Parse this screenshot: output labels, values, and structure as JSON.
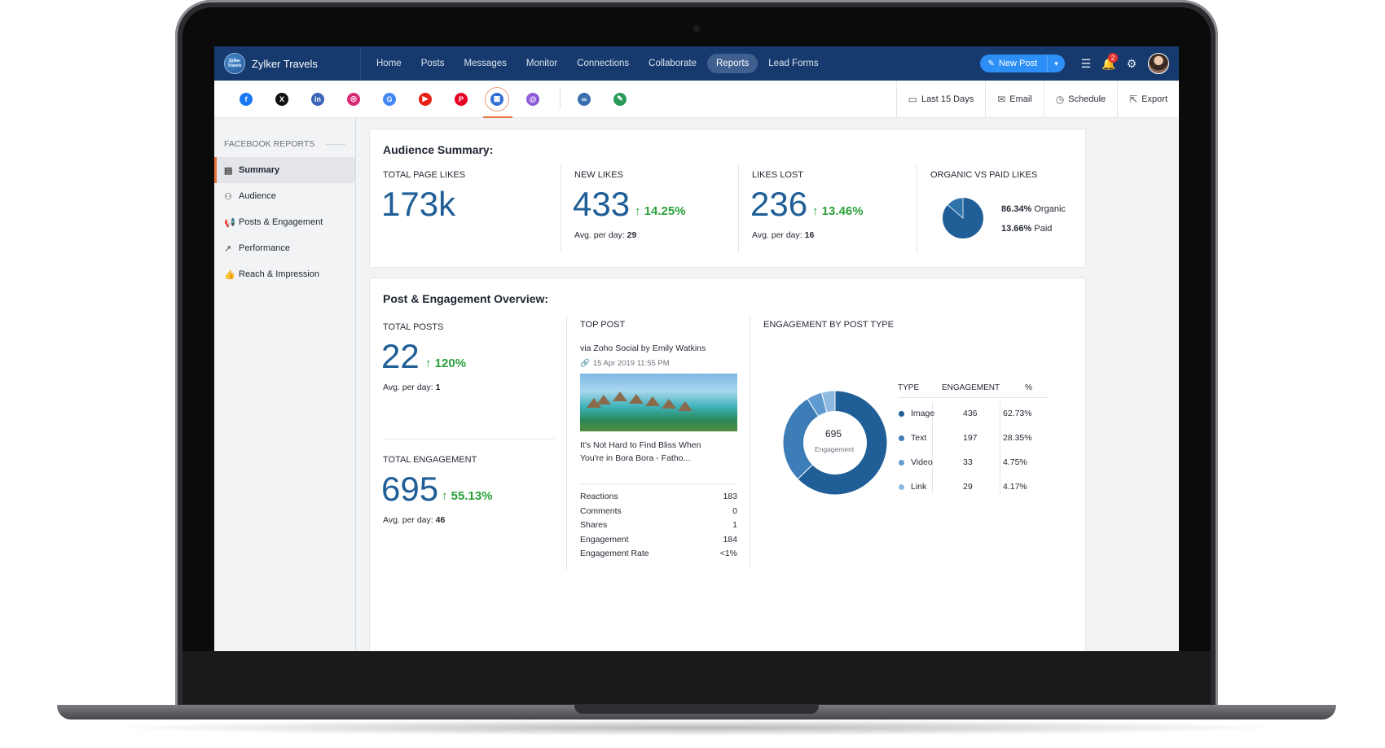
{
  "app": {
    "brand": "Zylker Travels",
    "brand_logo_text": "Zylker Travels",
    "nav": [
      "Home",
      "Posts",
      "Messages",
      "Monitor",
      "Connections",
      "Collaborate",
      "Reports",
      "Lead Forms"
    ],
    "active_nav": "Reports",
    "new_post_label": "New Post",
    "notification_count": "2"
  },
  "channels": [
    {
      "name": "facebook-channel",
      "glyph": "f",
      "color": "#1877f2"
    },
    {
      "name": "x-channel",
      "glyph": "X",
      "color": "#111111"
    },
    {
      "name": "linkedin-channel",
      "glyph": "in",
      "color": "#3a64b8"
    },
    {
      "name": "instagram-channel",
      "glyph": "◎",
      "color": "#d62976"
    },
    {
      "name": "google-channel",
      "glyph": "G",
      "color": "#4285f4"
    },
    {
      "name": "youtube-channel",
      "glyph": "▶",
      "color": "#e62117"
    },
    {
      "name": "pinterest-channel",
      "glyph": "P",
      "color": "#e60023"
    },
    {
      "name": "microsoft-channel",
      "glyph": "▦",
      "color": "#2f6fd1"
    },
    {
      "name": "threads-channel",
      "glyph": "@",
      "color": "#8e5ad6"
    }
  ],
  "extra_channels": [
    {
      "name": "link-channel",
      "glyph": "∞",
      "color": "#3a6fb0"
    },
    {
      "name": "leaf-channel",
      "glyph": "✎",
      "color": "#2a9a5a"
    }
  ],
  "actions": {
    "date_range": "Last 15 Days",
    "email": "Email",
    "schedule": "Schedule",
    "export": "Export"
  },
  "sidebar": {
    "title": "FACEBOOK REPORTS",
    "items": [
      "Summary",
      "Audience",
      "Posts & Engagement",
      "Performance",
      "Reach & Impression"
    ],
    "active": "Summary"
  },
  "audience_summary": {
    "title": "Audience Summary:",
    "total_page_likes": {
      "label": "TOTAL PAGE LIKES",
      "value": "173k"
    },
    "new_likes": {
      "label": "NEW LIKES",
      "value": "433",
      "delta": "14.25%",
      "avg_label": "Avg. per day:",
      "avg": "29"
    },
    "likes_lost": {
      "label": "LIKES LOST",
      "value": "236",
      "delta": "13.46%",
      "avg_label": "Avg. per day:",
      "avg": "16"
    },
    "organic_vs_paid": {
      "label": "ORGANIC VS PAID LIKES",
      "organic_pct": "86.34%",
      "organic_label": "Organic",
      "paid_pct": "13.66%",
      "paid_label": "Paid",
      "organic_fraction": 0.8634
    }
  },
  "post_engagement": {
    "title": "Post & Engagement Overview:",
    "total_posts": {
      "label": "TOTAL POSTS",
      "value": "22",
      "delta": "120%",
      "avg_label": "Avg. per day:",
      "avg": "1"
    },
    "total_engagement": {
      "label": "TOTAL ENGAGEMENT",
      "value": "695",
      "delta": "55.13%",
      "avg_label": "Avg. per day:",
      "avg": "46"
    },
    "top_post": {
      "label": "TOP POST",
      "via": "via Zoho Social by Emily Watkins",
      "date": "15 Apr 2019 11:55 PM",
      "caption_1": "It's Not Hard to Find Bliss When",
      "caption_2": "You're in Bora Bora - Fatho...",
      "stats": [
        {
          "label": "Reactions",
          "value": "183"
        },
        {
          "label": "Comments",
          "value": "0"
        },
        {
          "label": "Shares",
          "value": "1"
        },
        {
          "label": "Engagement",
          "value": "184"
        },
        {
          "label": "Engagement Rate",
          "value": "<1%"
        }
      ]
    },
    "by_type": {
      "label": "ENGAGEMENT BY POST TYPE",
      "center_value": "695",
      "center_label": "Engagement",
      "headers": [
        "TYPE",
        "ENGAGEMENT",
        "%"
      ],
      "rows": [
        {
          "type": "Image",
          "engagement": "436",
          "pct": "62.73%",
          "color": "#1f5e96"
        },
        {
          "type": "Text",
          "engagement": "197",
          "pct": "28.35%",
          "color": "#3c7db8"
        },
        {
          "type": "Video",
          "engagement": "33",
          "pct": "4.75%",
          "color": "#5f9bcf"
        },
        {
          "type": "Link",
          "engagement": "29",
          "pct": "4.17%",
          "color": "#8fbadf"
        }
      ]
    }
  },
  "chart_data": {
    "type": "pie",
    "title": "ENGAGEMENT BY POST TYPE",
    "categories": [
      "Image",
      "Text",
      "Video",
      "Link"
    ],
    "values": [
      436,
      197,
      33,
      29
    ]
  }
}
